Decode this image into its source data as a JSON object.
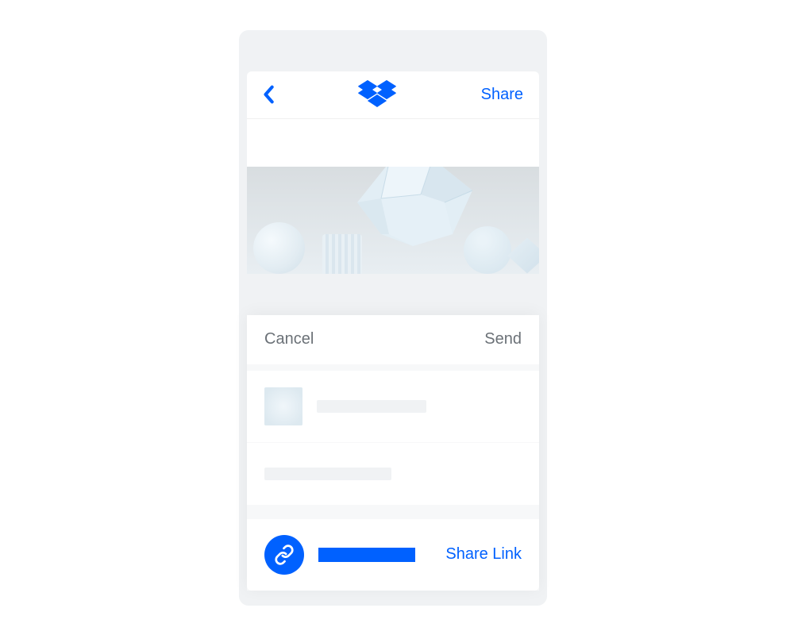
{
  "header": {
    "share_label": "Share"
  },
  "share_sheet": {
    "cancel_label": "Cancel",
    "send_label": "Send",
    "share_link_label": "Share Link"
  },
  "colors": {
    "accent": "#0061ff",
    "muted_text": "#6b7177",
    "placeholder": "#f0f2f4"
  }
}
